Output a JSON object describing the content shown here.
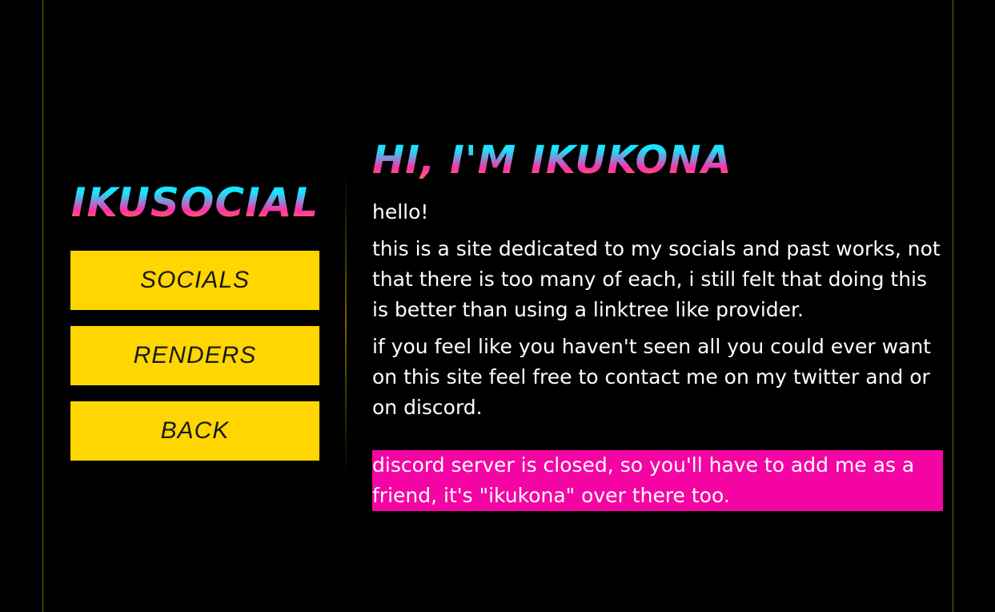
{
  "brand": {
    "title": "IKUSOCIAL"
  },
  "nav": {
    "items": [
      {
        "label": "SOCIALS"
      },
      {
        "label": "RENDERS"
      },
      {
        "label": "BACK"
      }
    ]
  },
  "main": {
    "heading": "HI, I'M IKUKONA",
    "paragraphs": [
      "hello!",
      "this is a site dedicated to my socials and past works, not that there is too many of each, i still felt that doing this is better than using a linktree like provider.",
      "if you feel like you haven't seen all you could ever want on this site feel free to contact me on my twitter and or on discord."
    ],
    "note": "discord server is closed, so you'll have to add me as a friend, it's \"ikukona\" over there too."
  },
  "colors": {
    "background": "#000000",
    "button": "#ffd600",
    "note_bg": "#f504a4",
    "gradient_top": "#19e3ff",
    "gradient_mid": "#ff2fa8",
    "gradient_bottom": "#ff9a1a",
    "frame_line": "#7a6400"
  }
}
